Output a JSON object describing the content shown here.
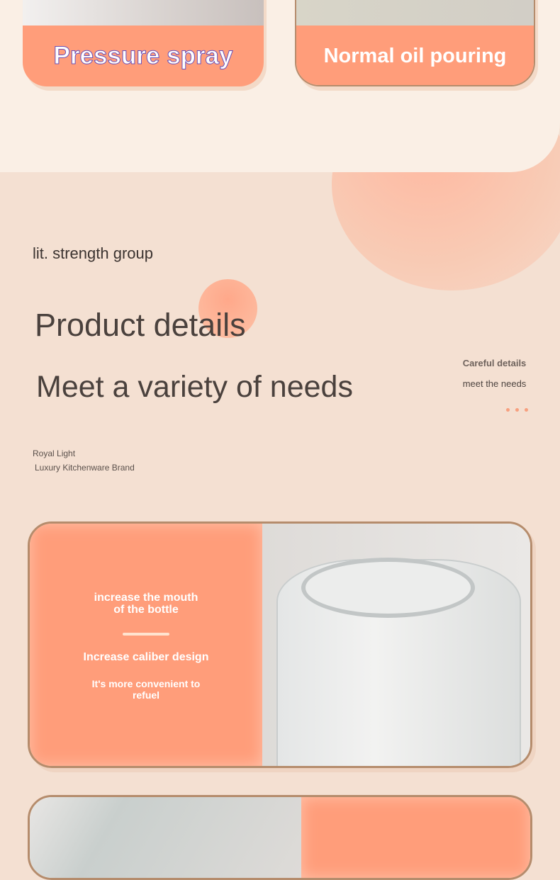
{
  "cards": [
    {
      "label": "Pressure spray"
    },
    {
      "label": "Normal oil pouring"
    }
  ],
  "brand": "lit. strength group",
  "heading": {
    "title": "Product details",
    "subtitle": "Meet a variety of needs"
  },
  "side": {
    "line1": "Careful details",
    "line2": "meet the needs"
  },
  "tagline": {
    "line1": "Royal Light",
    "line2": "Luxury Kitchenware Brand"
  },
  "feature": {
    "title": "increase the mouth of the bottle",
    "subtitle": "Increase caliber design",
    "desc": "It's more convenient to refuel"
  },
  "colors": {
    "accent": "#ff9d7a",
    "border": "#b58c6c",
    "background": "#f4e0d2"
  }
}
